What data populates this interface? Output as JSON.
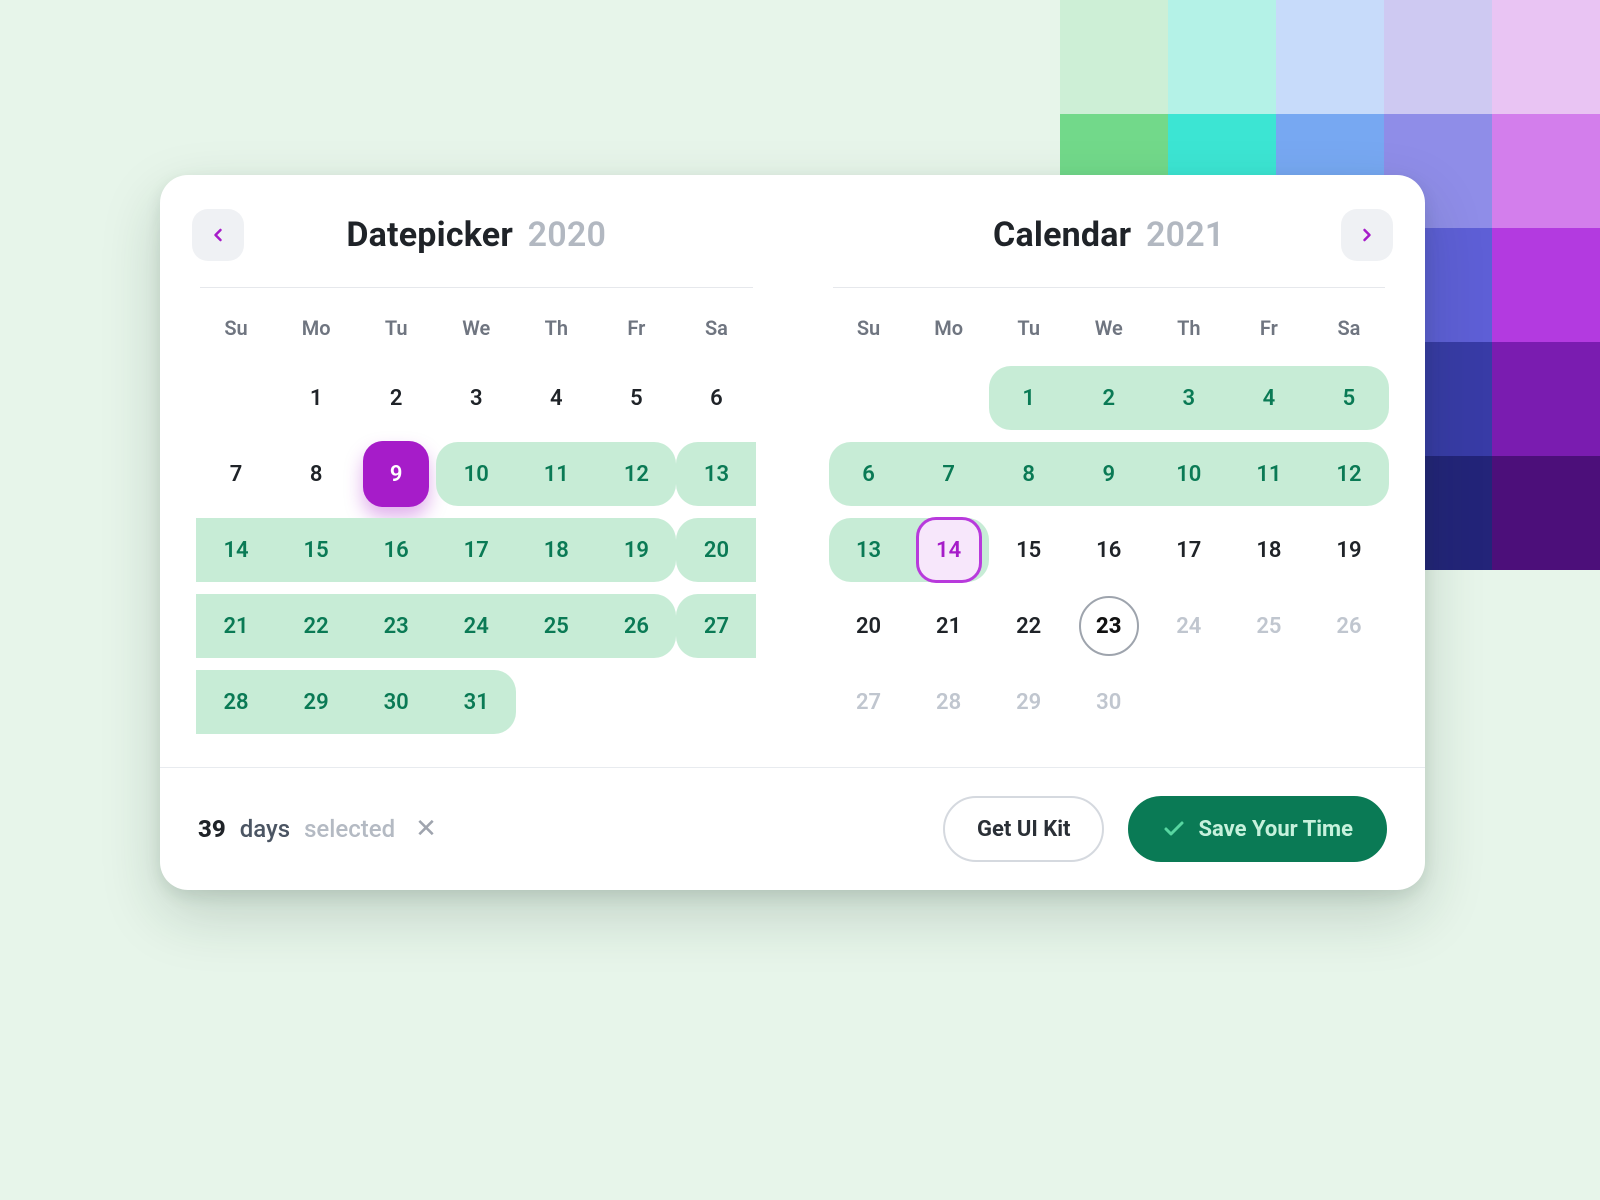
{
  "palette": [
    "#CDEFD6",
    "#B4F2E7",
    "#C7DBFA",
    "#CEC9F2",
    "#E9C4F3",
    "#72D98A",
    "#3CE5D3",
    "#77A8F2",
    "#8F8DE8",
    "#D37EEC",
    "#3FC46A",
    "#18C9C0",
    "#3D7FE6",
    "#5E5FD6",
    "#B33AE0",
    "#1E8C4E",
    "#0E8D8A",
    "#2652B3",
    "#383BA6",
    "#7A1CB0",
    "#10613A",
    "#0A5C5A",
    "#16387E",
    "#232479",
    "#4C0F7A"
  ],
  "weekdays": [
    "Su",
    "Mo",
    "Tu",
    "We",
    "Th",
    "Fr",
    "Sa"
  ],
  "left": {
    "title": "Datepicker",
    "year": "2020",
    "leading": 1,
    "days": [
      {
        "n": 1
      },
      {
        "n": 2
      },
      {
        "n": 3
      },
      {
        "n": 4
      },
      {
        "n": 5
      },
      {
        "n": 6
      },
      {
        "n": 7
      },
      {
        "n": 8
      },
      {
        "n": 9,
        "start": true
      },
      {
        "n": 10,
        "sel": true,
        "first": true
      },
      {
        "n": 11,
        "sel": true
      },
      {
        "n": 12,
        "sel": true,
        "last": true
      },
      {
        "n": 13,
        "sel": true,
        "first": true
      },
      {
        "n": 14,
        "sel": true
      },
      {
        "n": 15,
        "sel": true
      },
      {
        "n": 16,
        "sel": true
      },
      {
        "n": 17,
        "sel": true
      },
      {
        "n": 18,
        "sel": true
      },
      {
        "n": 19,
        "sel": true,
        "last": true
      },
      {
        "n": 20,
        "sel": true,
        "first": true
      },
      {
        "n": 21,
        "sel": true
      },
      {
        "n": 22,
        "sel": true
      },
      {
        "n": 23,
        "sel": true
      },
      {
        "n": 24,
        "sel": true
      },
      {
        "n": 25,
        "sel": true
      },
      {
        "n": 26,
        "sel": true,
        "last": true
      },
      {
        "n": 27,
        "sel": true,
        "first": true
      },
      {
        "n": 28,
        "sel": true
      },
      {
        "n": 29,
        "sel": true
      },
      {
        "n": 30,
        "sel": true
      },
      {
        "n": 31,
        "sel": true,
        "last": true
      }
    ]
  },
  "right": {
    "title": "Calendar",
    "year": "2021",
    "leading": 2,
    "days": [
      {
        "n": 1,
        "sel": true,
        "first": true
      },
      {
        "n": 2,
        "sel": true
      },
      {
        "n": 3,
        "sel": true
      },
      {
        "n": 4,
        "sel": true
      },
      {
        "n": 5,
        "sel": true,
        "last": true
      },
      {
        "n": 6,
        "sel": true,
        "first": true
      },
      {
        "n": 7,
        "sel": true
      },
      {
        "n": 8,
        "sel": true
      },
      {
        "n": 9,
        "sel": true
      },
      {
        "n": 10,
        "sel": true
      },
      {
        "n": 11,
        "sel": true
      },
      {
        "n": 12,
        "sel": true,
        "last": true
      },
      {
        "n": 13,
        "sel": true,
        "first": true
      },
      {
        "n": 14,
        "end": true
      },
      {
        "n": 15
      },
      {
        "n": 16
      },
      {
        "n": 17
      },
      {
        "n": 18
      },
      {
        "n": 19
      },
      {
        "n": 20
      },
      {
        "n": 21
      },
      {
        "n": 22
      },
      {
        "n": 23,
        "today": true
      },
      {
        "n": 24,
        "dim": true
      },
      {
        "n": 25,
        "dim": true
      },
      {
        "n": 26,
        "dim": true
      },
      {
        "n": 27,
        "dim": true
      },
      {
        "n": 28,
        "dim": true
      },
      {
        "n": 29,
        "dim": true
      },
      {
        "n": 30,
        "dim": true
      }
    ]
  },
  "footer": {
    "count": "39",
    "days_word": "days",
    "selected_word": "selected",
    "outline": "Get UI Kit",
    "solid": "Save Your Time"
  }
}
